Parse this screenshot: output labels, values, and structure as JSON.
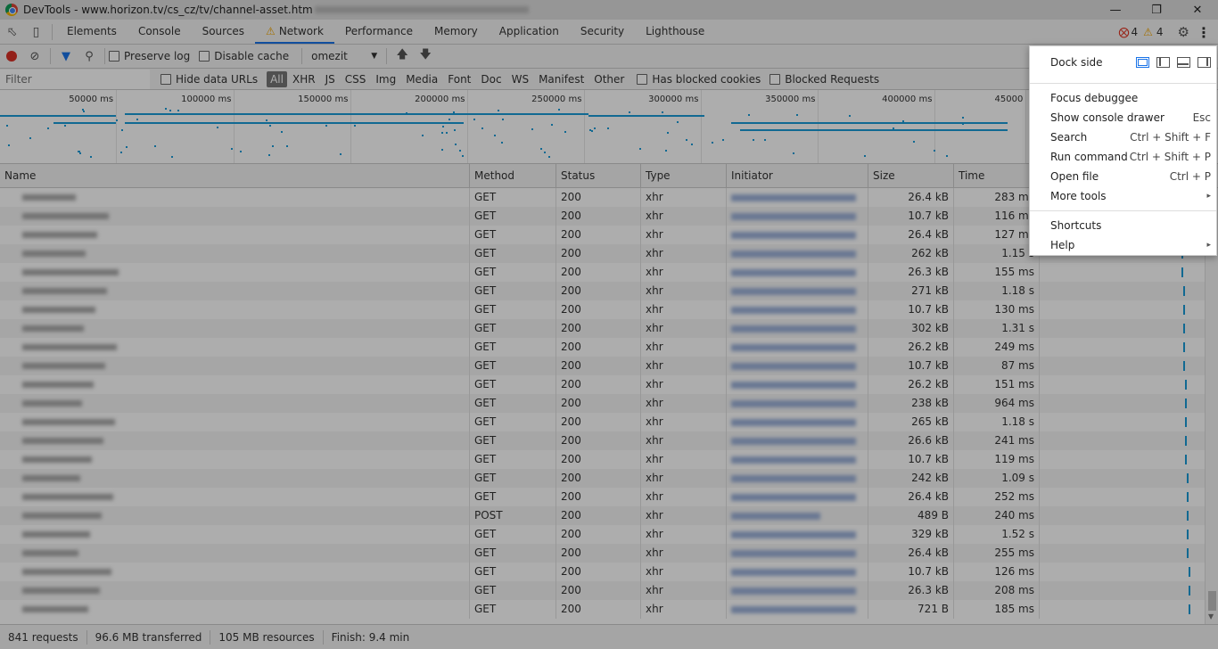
{
  "window": {
    "title": "DevTools - www.horizon.tv/cs_cz/tv/channel-asset.htm",
    "minimize": "—",
    "restore": "❐",
    "close": "✕"
  },
  "tabs": [
    {
      "label": "Elements"
    },
    {
      "label": "Console"
    },
    {
      "label": "Sources"
    },
    {
      "label": "Network"
    },
    {
      "label": "Performance"
    },
    {
      "label": "Memory"
    },
    {
      "label": "Application"
    },
    {
      "label": "Security"
    },
    {
      "label": "Lighthouse"
    }
  ],
  "active_tab": "Network",
  "issues": {
    "errors": "4",
    "warnings": "4"
  },
  "toolbar": {
    "preserve_log": "Preserve log",
    "disable_cache": "Disable cache",
    "throttle": "omezit"
  },
  "filter": {
    "placeholder": "Filter",
    "hide_data_urls": "Hide data URLs",
    "types": [
      "All",
      "XHR",
      "JS",
      "CSS",
      "Img",
      "Media",
      "Font",
      "Doc",
      "WS",
      "Manifest",
      "Other"
    ],
    "has_blocked_cookies": "Has blocked cookies",
    "blocked_requests": "Blocked Requests"
  },
  "overview": {
    "ticks": [
      "50000 ms",
      "100000 ms",
      "150000 ms",
      "200000 ms",
      "250000 ms",
      "300000 ms",
      "350000 ms",
      "400000 ms",
      "45000"
    ]
  },
  "columns": {
    "name": "Name",
    "method": "Method",
    "status": "Status",
    "type": "Type",
    "initiator": "Initiator",
    "size": "Size",
    "time": "Time"
  },
  "rows": [
    {
      "method": "GET",
      "status": "200",
      "type": "xhr",
      "size": "26.4 kB",
      "time": "283 ms",
      "wf": 0.86
    },
    {
      "method": "GET",
      "status": "200",
      "type": "xhr",
      "size": "10.7 kB",
      "time": "116 ms",
      "wf": 0.86
    },
    {
      "method": "GET",
      "status": "200",
      "type": "xhr",
      "size": "26.4 kB",
      "time": "127 ms",
      "wf": 0.86
    },
    {
      "method": "GET",
      "status": "200",
      "type": "xhr",
      "size": "262 kB",
      "time": "1.15 s",
      "wf": 0.86
    },
    {
      "method": "GET",
      "status": "200",
      "type": "xhr",
      "size": "26.3 kB",
      "time": "155 ms",
      "wf": 0.86
    },
    {
      "method": "GET",
      "status": "200",
      "type": "xhr",
      "size": "271 kB",
      "time": "1.18 s",
      "wf": 0.87
    },
    {
      "method": "GET",
      "status": "200",
      "type": "xhr",
      "size": "10.7 kB",
      "time": "130 ms",
      "wf": 0.87
    },
    {
      "method": "GET",
      "status": "200",
      "type": "xhr",
      "size": "302 kB",
      "time": "1.31 s",
      "wf": 0.87
    },
    {
      "method": "GET",
      "status": "200",
      "type": "xhr",
      "size": "26.2 kB",
      "time": "249 ms",
      "wf": 0.87
    },
    {
      "method": "GET",
      "status": "200",
      "type": "xhr",
      "size": "10.7 kB",
      "time": "87 ms",
      "wf": 0.87
    },
    {
      "method": "GET",
      "status": "200",
      "type": "xhr",
      "size": "26.2 kB",
      "time": "151 ms",
      "wf": 0.88
    },
    {
      "method": "GET",
      "status": "200",
      "type": "xhr",
      "size": "238 kB",
      "time": "964 ms",
      "wf": 0.88
    },
    {
      "method": "GET",
      "status": "200",
      "type": "xhr",
      "size": "265 kB",
      "time": "1.18 s",
      "wf": 0.88
    },
    {
      "method": "GET",
      "status": "200",
      "type": "xhr",
      "size": "26.6 kB",
      "time": "241 ms",
      "wf": 0.88
    },
    {
      "method": "GET",
      "status": "200",
      "type": "xhr",
      "size": "10.7 kB",
      "time": "119 ms",
      "wf": 0.88
    },
    {
      "method": "GET",
      "status": "200",
      "type": "xhr",
      "size": "242 kB",
      "time": "1.09 s",
      "wf": 0.89
    },
    {
      "method": "GET",
      "status": "200",
      "type": "xhr",
      "size": "26.4 kB",
      "time": "252 ms",
      "wf": 0.89
    },
    {
      "method": "POST",
      "status": "200",
      "type": "xhr",
      "size": "489 B",
      "time": "240 ms",
      "wf": 0.89
    },
    {
      "method": "GET",
      "status": "200",
      "type": "xhr",
      "size": "329 kB",
      "time": "1.52 s",
      "wf": 0.89
    },
    {
      "method": "GET",
      "status": "200",
      "type": "xhr",
      "size": "26.4 kB",
      "time": "255 ms",
      "wf": 0.89
    },
    {
      "method": "GET",
      "status": "200",
      "type": "xhr",
      "size": "10.7 kB",
      "time": "126 ms",
      "wf": 0.9
    },
    {
      "method": "GET",
      "status": "200",
      "type": "xhr",
      "size": "26.3 kB",
      "time": "208 ms",
      "wf": 0.9
    },
    {
      "method": "GET",
      "status": "200",
      "type": "xhr",
      "size": "721 B",
      "time": "185 ms",
      "wf": 0.9
    }
  ],
  "status": {
    "requests": "841 requests",
    "transferred": "96.6 MB transferred",
    "resources": "105 MB resources",
    "finish": "Finish: 9.4 min"
  },
  "menu": {
    "dock_side": "Dock side",
    "items": [
      {
        "label": "Focus debuggee",
        "shortcut": ""
      },
      {
        "label": "Show console drawer",
        "shortcut": "Esc"
      },
      {
        "label": "Search",
        "shortcut": "Ctrl + Shift + F"
      },
      {
        "label": "Run command",
        "shortcut": "Ctrl + Shift + P"
      },
      {
        "label": "Open file",
        "shortcut": "Ctrl + P"
      },
      {
        "label": "More tools",
        "shortcut": "▸"
      }
    ],
    "items2": [
      {
        "label": "Shortcuts",
        "shortcut": ""
      },
      {
        "label": "Help",
        "shortcut": "▸"
      }
    ]
  },
  "colors": {
    "accent": "#1a73e8",
    "waterfall": "#1a9bd7",
    "record": "#d93025"
  }
}
